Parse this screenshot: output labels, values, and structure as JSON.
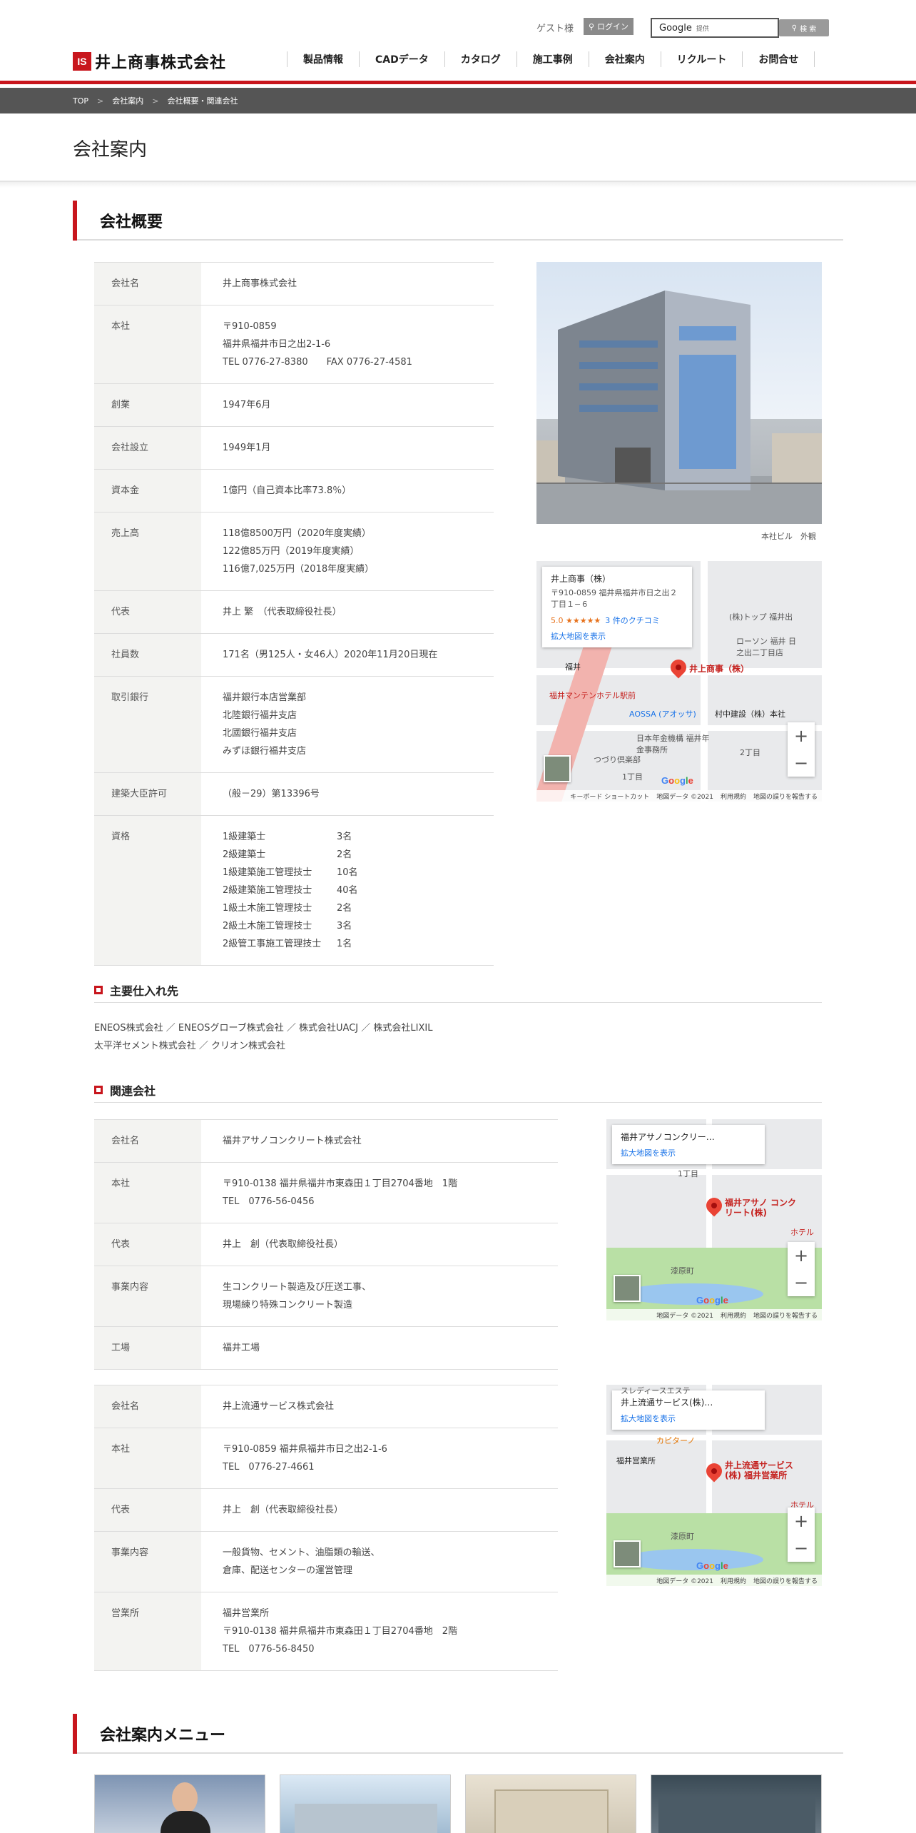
{
  "header": {
    "guest_label": "ゲスト様",
    "login_label": "ログイン",
    "search_placeholder": "Google",
    "search_sub": "提供",
    "search_button": "検 索",
    "logo_mark": "IS",
    "logo_text": "井上商事株式会社",
    "nav": [
      "製品情報",
      "CADデータ",
      "カタログ",
      "施工事例",
      "会社案内",
      "リクルート",
      "お問合せ"
    ]
  },
  "breadcrumb": [
    "TOP",
    "会社案内",
    "会社概要・関連会社"
  ],
  "page_title": "会社案内",
  "company_section": {
    "heading": "会社概要",
    "rows": [
      {
        "label": "会社名",
        "lines": [
          "井上商事株式会社"
        ]
      },
      {
        "label": "本社",
        "lines": [
          "〒910-0859",
          "福井県福井市日之出2-1-6",
          "TEL 0776-27-8380　　FAX 0776-27-4581"
        ]
      },
      {
        "label": "創業",
        "lines": [
          "1947年6月"
        ]
      },
      {
        "label": "会社設立",
        "lines": [
          "1949年1月"
        ]
      },
      {
        "label": "資本金",
        "lines": [
          "1億円（自己資本比率73.8％）"
        ]
      },
      {
        "label": "売上高",
        "lines": [
          "118億8500万円（2020年度実績）",
          "122億85万円（2019年度実績）",
          "116億7,025万円（2018年度実績）"
        ]
      },
      {
        "label": "代表",
        "lines": [
          "井上 繁　（代表取締役社長）"
        ]
      },
      {
        "label": "社員数",
        "lines": [
          "171名（男125人・女46人）2020年11月20日現在"
        ]
      },
      {
        "label": "取引銀行",
        "lines": [
          "福井銀行本店営業部",
          "北陸銀行福井支店",
          "北國銀行福井支店",
          "みずほ銀行福井支店"
        ]
      },
      {
        "label": "建築大臣許可",
        "lines": [
          "（般－29）第13396号"
        ]
      }
    ],
    "qualifications_label": "資格",
    "qualifications": [
      {
        "name": "1級建築士",
        "count": "3名"
      },
      {
        "name": "2級建築士",
        "count": "2名"
      },
      {
        "name": "1級建築施工管理技士",
        "count": "10名"
      },
      {
        "name": "2級建築施工管理技士",
        "count": "40名"
      },
      {
        "name": "1級土木施工管理技士",
        "count": "2名"
      },
      {
        "name": "2級土木施工管理技士",
        "count": "3名"
      },
      {
        "name": "2級管工事施工管理技士",
        "count": "1名"
      }
    ],
    "photo_caption": "本社ビル　外観"
  },
  "map_main": {
    "place": "井上商事（株）",
    "address": "〒910-0859 福井県福井市日之出２丁目１−６",
    "rating": "5.0 ★★★★★",
    "reviews": "3 件のクチコミ",
    "link": "拡大地図を表示",
    "pin_label": "井上商事（株）",
    "labels": [
      "(株)トップ 福井出",
      "ローソン 福井 日之出二丁目店",
      "福井マンテンホテル駅前",
      "AOSSA (アオッサ)",
      "村中建設（株）本社",
      "日本年金機構 福井年金事務所",
      "つづり倶楽部",
      "福井",
      "1丁目",
      "2丁目"
    ],
    "footer": [
      "キーボード ショートカット",
      "地図データ ©2021",
      "利用規約",
      "地図の誤りを報告する"
    ]
  },
  "suppliers": {
    "heading": "主要仕入れ先",
    "lines": [
      "ENEOS株式会社 ／ ENEOSグローブ株式会社 ／ 株式会社UACJ ／ 株式会社LIXIL",
      "太平洋セメント株式会社 ／ クリオン株式会社"
    ]
  },
  "affiliates": {
    "heading": "関連会社",
    "companies": [
      {
        "rows": [
          {
            "label": "会社名",
            "lines": [
              "福井アサノコンクリート株式会社"
            ]
          },
          {
            "label": "本社",
            "lines": [
              "〒910-0138 福井県福井市東森田１丁目2704番地　1階",
              "TEL　0776-56-0456"
            ]
          },
          {
            "label": "代表",
            "lines": [
              "井上　創（代表取締役社長）"
            ]
          },
          {
            "label": "事業内容",
            "lines": [
              "生コンクリート製造及び圧送工事、",
              "現場練り特殊コンクリート製造"
            ]
          },
          {
            "label": "工場",
            "lines": [
              "福井工場"
            ]
          }
        ],
        "map": {
          "place": "福井アサノコンクリー…",
          "link": "拡大地図を表示",
          "pin_label": "福井アサノ コンクリート(株)",
          "labels": [
            "1丁目",
            "漆原町",
            "ホテル"
          ],
          "footer": [
            "地図データ ©2021",
            "利用規約",
            "地図の誤りを報告する"
          ]
        }
      },
      {
        "rows": [
          {
            "label": "会社名",
            "lines": [
              "井上流通サービス株式会社"
            ]
          },
          {
            "label": "本社",
            "lines": [
              "〒910-0859 福井県福井市日之出2-1-6",
              "TEL　0776-27-4661"
            ]
          },
          {
            "label": "代表",
            "lines": [
              "井上　創（代表取締役社長）"
            ]
          },
          {
            "label": "事業内容",
            "lines": [
              "一般貨物、セメント、油脂類の輸送、",
              "倉庫、配送センターの運営管理"
            ]
          },
          {
            "label": "営業所",
            "lines": [
              "福井営業所",
              "〒910-0138 福井県福井市東森田１丁目2704番地　2階",
              "TEL　0776-56-8450"
            ]
          }
        ],
        "map": {
          "place": "井上流通サービス(株)…",
          "link": "拡大地図を表示",
          "pin_label": "井上流通サービス (株) 福井営業所",
          "labels": [
            "カピターノ",
            "福井営業所",
            "漆原町",
            "ホテル",
            "スレディースエステ"
          ],
          "footer": [
            "地図データ ©2021",
            "利用規約",
            "地図の誤りを報告する"
          ]
        }
      }
    ]
  },
  "menu_section": {
    "heading": "会社案内メニュー"
  },
  "colors": {
    "accent": "#c8161d",
    "breadcrumb_bg": "#555555",
    "th_bg": "#f3f3f1"
  }
}
